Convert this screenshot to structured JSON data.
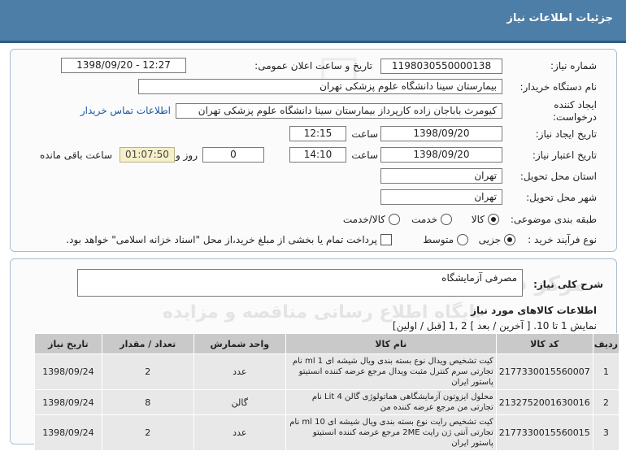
{
  "header": {
    "title": "جزئیات اطلاعات نیاز"
  },
  "fields": {
    "need_number_label": "شماره نیاز:",
    "need_number": "1198030550000138",
    "announce_label": "تاریخ و ساعت اعلان عمومی:",
    "announce_value": "1398/09/20 - 12:27",
    "buyer_label": "نام دستگاه خریدار:",
    "buyer_value": "بیمارستان سینا دانشگاه علوم پزشکی تهران",
    "creator_label_1": "ایجاد کننده",
    "creator_label_2": "درخواست:",
    "creator_value": "کیومرث باباجان زاده  کارپرداز بیمارستان سینا دانشگاه علوم پزشکی تهران",
    "contact_link": "اطلاعات تماس خریدار",
    "create_date_label": "تاریخ ایجاد نیاز:",
    "create_date": "1398/09/20",
    "time_label": "ساعت",
    "create_time": "12:15",
    "validity_label": "تاریخ اعتبار نیاز:",
    "validity_date": "1398/09/20",
    "validity_time": "14:10",
    "days_value": "0",
    "days_label": "روز و",
    "remaining_time": "01:07:50",
    "remaining_label": "ساعت باقی مانده",
    "province_label": "استان محل تحویل:",
    "province_value": "تهران",
    "city_label": "شهر محل تحویل:",
    "city_value": "تهران",
    "category_label": "طبقه بندی موضوعی:",
    "cat_goods": "کالا",
    "cat_service": "خدمت",
    "cat_goods_service": "کالا/خدمت",
    "process_label": "نوع فرآیند خرید :",
    "proc_partial": "جزیی",
    "proc_medium": "متوسط",
    "payment_note": "پرداخت تمام یا بخشی از مبلغ خرید،از محل \"اسناد خزانه اسلامی\" خواهد بود."
  },
  "description": {
    "label": "شرح کلی نیاز:",
    "value": "مصرفی آزمایشگاه"
  },
  "goods": {
    "title": "اطلاعات کالاهای مورد نیاز",
    "paging": "نمایش 1 تا 10. [ آخرین / بعد ] 2 ,1 [قبل / اولین]",
    "columns": [
      "ردیف",
      "کد کالا",
      "نام کالا",
      "واحد شمارش",
      "تعداد / مقدار",
      "تاریخ نیاز"
    ],
    "rows": [
      {
        "row": "1",
        "code": "2177330015560007",
        "name": "کیت تشخیص ویدال نوع بسته بندی ویال شیشه ای 1 ml نام تجارتی سرم کنترل مثبت ویدال مرجع عرضه کننده انستیتو پاستور ایران",
        "unit": "عدد",
        "qty": "2",
        "date": "1398/09/24"
      },
      {
        "row": "2",
        "code": "2132752001630016",
        "name": "محلول ایزوتون آزمایشگاهی هماتولوژی گالن 4 Lit نام تجارتی من مرجع عرضه کننده من",
        "unit": "گالن",
        "qty": "8",
        "date": "1398/09/24"
      },
      {
        "row": "3",
        "code": "2177330015560015",
        "name": "کیت تشخیص رایت نوع بسته بندی ویال شیشه ای 10 ml نام تجارتی آنتی ژن رایت 2ME مرجع عرضه کننده انستیتو پاستور ایران",
        "unit": "عدد",
        "qty": "2",
        "date": "1398/09/24"
      }
    ]
  }
}
